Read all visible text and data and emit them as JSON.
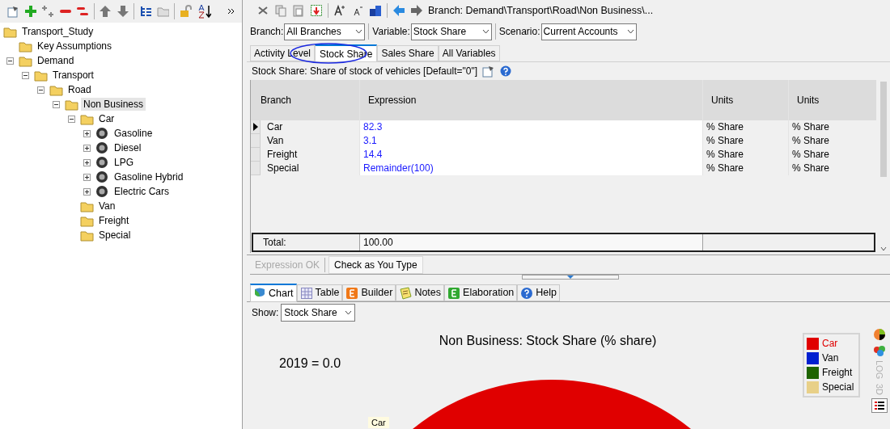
{
  "tree": [
    {
      "label": "Transport_Study",
      "kind": "folder",
      "selected": false,
      "children": [
        {
          "label": "Key Assumptions",
          "kind": "folder",
          "selected": false
        },
        {
          "label": "Demand",
          "kind": "folder",
          "selected": false,
          "expanded": true,
          "children": [
            {
              "label": "Transport",
              "kind": "folder",
              "selected": false,
              "expanded": true,
              "children": [
                {
                  "label": "Road",
                  "kind": "folder",
                  "selected": false,
                  "expanded": true,
                  "children": [
                    {
                      "label": "Non Business",
                      "kind": "folder",
                      "selected": true,
                      "expanded": true,
                      "children": [
                        {
                          "label": "Car",
                          "kind": "folder",
                          "selected": false,
                          "expanded": true,
                          "children": [
                            {
                              "label": "Gasoline",
                              "kind": "tire",
                              "selected": false,
                              "expanded": false
                            },
                            {
                              "label": "Diesel",
                              "kind": "tire",
                              "selected": false,
                              "expanded": false
                            },
                            {
                              "label": "LPG",
                              "kind": "tire",
                              "selected": false,
                              "expanded": false
                            },
                            {
                              "label": "Gasoline Hybrid",
                              "kind": "tire",
                              "selected": false,
                              "expanded": false
                            },
                            {
                              "label": "Electric Cars",
                              "kind": "tire",
                              "selected": false,
                              "expanded": false
                            }
                          ]
                        },
                        {
                          "label": "Van",
                          "kind": "folder",
                          "selected": false
                        },
                        {
                          "label": "Freight",
                          "kind": "folder",
                          "selected": false
                        },
                        {
                          "label": "Special",
                          "kind": "folder",
                          "selected": false
                        }
                      ]
                    }
                  ]
                }
              ]
            }
          ]
        }
      ]
    }
  ],
  "breadcrumb": "Branch: Demand\\Transport\\Road\\Non Business\\...",
  "filters": [
    {
      "label": "Branch:",
      "value": "All Branches"
    },
    {
      "label": "Variable:",
      "value": "Stock Share"
    },
    {
      "label": "Scenario:",
      "value": "Current Accounts"
    }
  ],
  "variable_tabs": [
    {
      "label": "Activity Level",
      "selected": false
    },
    {
      "label": "Stock Share",
      "selected": true
    },
    {
      "label": "Sales Share",
      "selected": false
    },
    {
      "label": "All Variables",
      "selected": false
    }
  ],
  "variable_description": "Stock Share: Share of stock of vehicles [Default=\"0\"]",
  "table": {
    "columns": [
      "Branch",
      "Expression",
      "Units",
      "Units"
    ],
    "rows": [
      {
        "cells": [
          "Car",
          "82.3",
          "% Share",
          "% Share"
        ],
        "selected": true
      },
      {
        "cells": [
          "Van",
          "3.1",
          "% Share",
          "% Share"
        ],
        "selected": false
      },
      {
        "cells": [
          "Freight",
          "14.4",
          "% Share",
          "% Share"
        ],
        "selected": false
      },
      {
        "cells": [
          "Special",
          "Remainder(100)",
          "% Share",
          "% Share"
        ],
        "selected": false
      }
    ],
    "total_label": "Total:",
    "total_value": "100.00"
  },
  "expression_status": {
    "label": "Expression OK",
    "disabled": true
  },
  "check_button": "Check as You Type",
  "view_tabs": [
    {
      "label": "Chart",
      "kind": "chart",
      "selected": true
    },
    {
      "label": "Table",
      "kind": "grid",
      "selected": false
    },
    {
      "label": "Builder",
      "kind": "builder",
      "selected": false
    },
    {
      "label": "Notes",
      "kind": "notes",
      "selected": false
    },
    {
      "label": "Elaboration",
      "kind": "elaboration",
      "selected": false
    },
    {
      "label": "Help",
      "kind": "help",
      "selected": false
    }
  ],
  "show": {
    "label": "Show:",
    "value": "Stock Share"
  },
  "chart": {
    "title": "Non Business: Stock Share (% share)",
    "year_label": "2019 = 0.0",
    "slice_label": "Car",
    "legend": [
      {
        "label": "Car",
        "color": "#e00000",
        "selected": true
      },
      {
        "label": "Van",
        "color": "#0020d0",
        "selected": false
      },
      {
        "label": "Freight",
        "color": "#1e6400",
        "selected": false
      },
      {
        "label": "Special",
        "color": "#e8d088",
        "selected": false
      }
    ],
    "side_options": [
      "LOG",
      "3D"
    ]
  }
}
